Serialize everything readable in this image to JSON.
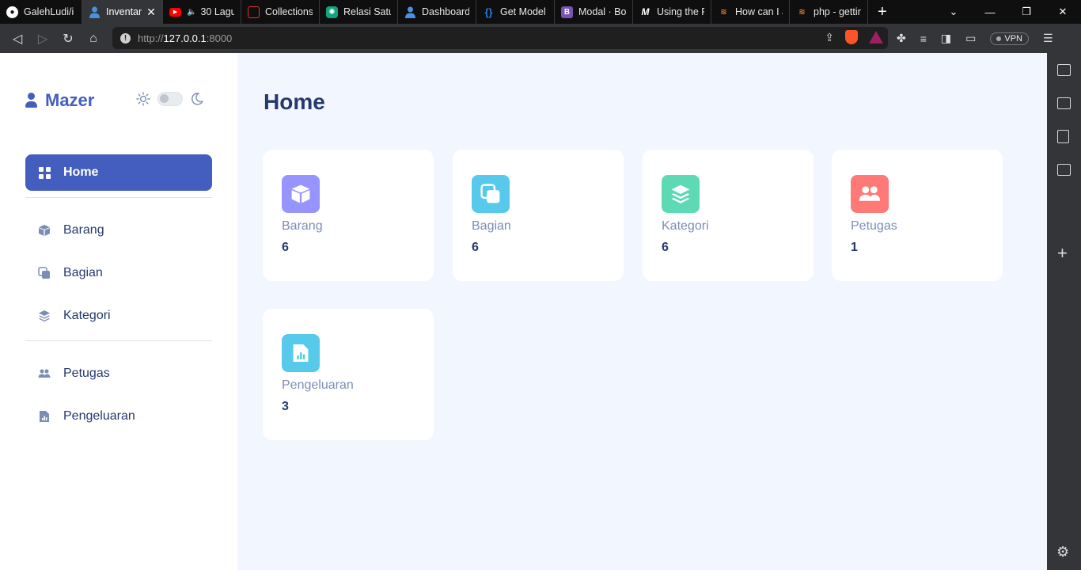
{
  "browser": {
    "tabs": [
      {
        "title": "GalehLudi/i",
        "color": "#24292f",
        "icon": "github-icon"
      },
      {
        "title": "Inventar",
        "color": "#435ebe",
        "icon": "mazer-icon",
        "active": true
      },
      {
        "title": "30 Lagu",
        "color": "#ff0000",
        "icon": "youtube-icon"
      },
      {
        "title": "Collections",
        "color": "#e3342f",
        "icon": "laravel-icon"
      },
      {
        "title": "Relasi Satu-",
        "color": "#10a37f",
        "icon": "chatgpt-icon"
      },
      {
        "title": "Dashboard",
        "color": "#435ebe",
        "icon": "mazer-icon"
      },
      {
        "title": "Get Model",
        "color": "#2c7be5",
        "icon": "braces-icon"
      },
      {
        "title": "Modal · Boo",
        "color": "#7952b3",
        "icon": "bootstrap-icon"
      },
      {
        "title": "Using the F",
        "color": "#444444",
        "icon": "medium-icon"
      },
      {
        "title": "How can I a",
        "color": "#f48024",
        "icon": "stackoverflow-icon"
      },
      {
        "title": "php - gettin",
        "color": "#f48024",
        "icon": "stackoverflow-icon"
      }
    ],
    "url_scheme": "http://",
    "url_host": "127.0.0.1",
    "url_port": ":8000",
    "vpn_label": "VPN"
  },
  "sidebar": {
    "brand": "Mazer",
    "menu_primary": [
      {
        "label": "Home",
        "icon": "grid-icon",
        "active": true
      }
    ],
    "menu_secondary": [
      {
        "label": "Barang",
        "icon": "box-icon"
      },
      {
        "label": "Bagian",
        "icon": "layers-copy-icon"
      },
      {
        "label": "Kategori",
        "icon": "stack-icon"
      }
    ],
    "menu_tertiary": [
      {
        "label": "Petugas",
        "icon": "people-icon"
      },
      {
        "label": "Pengeluaran",
        "icon": "report-file-icon"
      }
    ]
  },
  "main": {
    "title": "Home",
    "cards": [
      {
        "label": "Barang",
        "value": "6",
        "color": "#9694ff",
        "icon": "box-icon"
      },
      {
        "label": "Bagian",
        "value": "6",
        "color": "#57caeb",
        "icon": "layers-copy-icon"
      },
      {
        "label": "Kategori",
        "value": "6",
        "color": "#5ddab4",
        "icon": "stack-icon"
      },
      {
        "label": "Petugas",
        "value": "1",
        "color": "#ff7976",
        "icon": "people-icon"
      },
      {
        "label": "Pengeluaran",
        "value": "3",
        "color": "#57caeb",
        "icon": "report-file-icon"
      }
    ]
  },
  "colors": {
    "primary": "#435ebe",
    "heading": "#25396f",
    "muted": "#7c8db5",
    "background": "#f2f7ff"
  }
}
